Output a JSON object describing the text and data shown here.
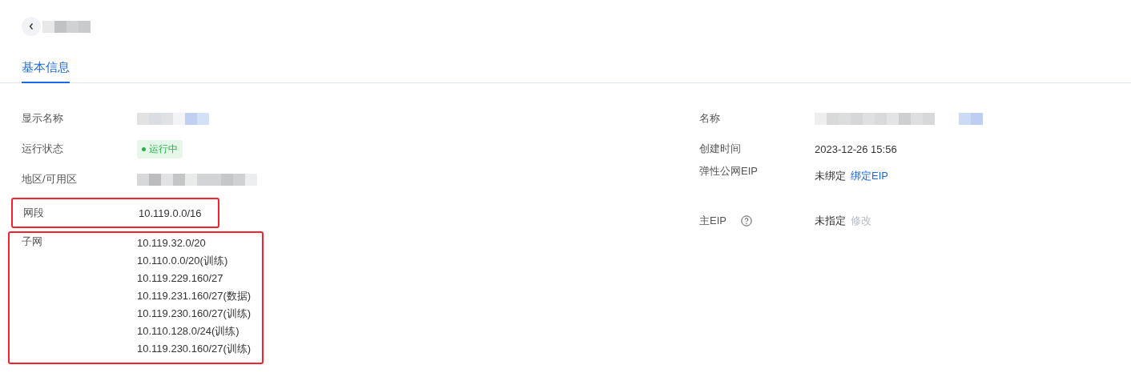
{
  "tabs": [
    {
      "label": "基本信息",
      "selected": true
    }
  ],
  "left_fields": [
    {
      "label": "显示名称",
      "kind": "blurred",
      "highlighted": false
    },
    {
      "label": "运行状态",
      "kind": "status",
      "status": {
        "text": "运行中",
        "color": "#22b14c"
      },
      "highlighted": false
    },
    {
      "label": "地区/可用区",
      "kind": "blurred",
      "highlighted": false
    },
    {
      "label": "网段",
      "kind": "text",
      "value": "10.119.0.0/16",
      "highlighted": true
    },
    {
      "label": "子网",
      "kind": "list",
      "values": [
        "10.119.32.0/20",
        "10.110.0.0/20(训练)",
        "10.119.229.160/27",
        "10.119.231.160/27(数据)",
        "10.119.230.160/27(训练)",
        "10.110.128.0/24(训练)",
        "10.119.230.160/27(训练)"
      ],
      "highlighted": true
    }
  ],
  "right_fields": [
    {
      "label": "名称",
      "kind": "blurred"
    },
    {
      "label": "创建时间",
      "kind": "text",
      "value": "2023-12-26 15:56"
    },
    {
      "label": "弹性公网EIP",
      "kind": "action",
      "value": "未绑定",
      "link": {
        "text": "绑定EIP",
        "disabled": false
      }
    },
    {
      "label": "主EIP",
      "kind": "action",
      "help": true,
      "value": "未指定",
      "link": {
        "text": "修改",
        "disabled": true
      }
    }
  ]
}
